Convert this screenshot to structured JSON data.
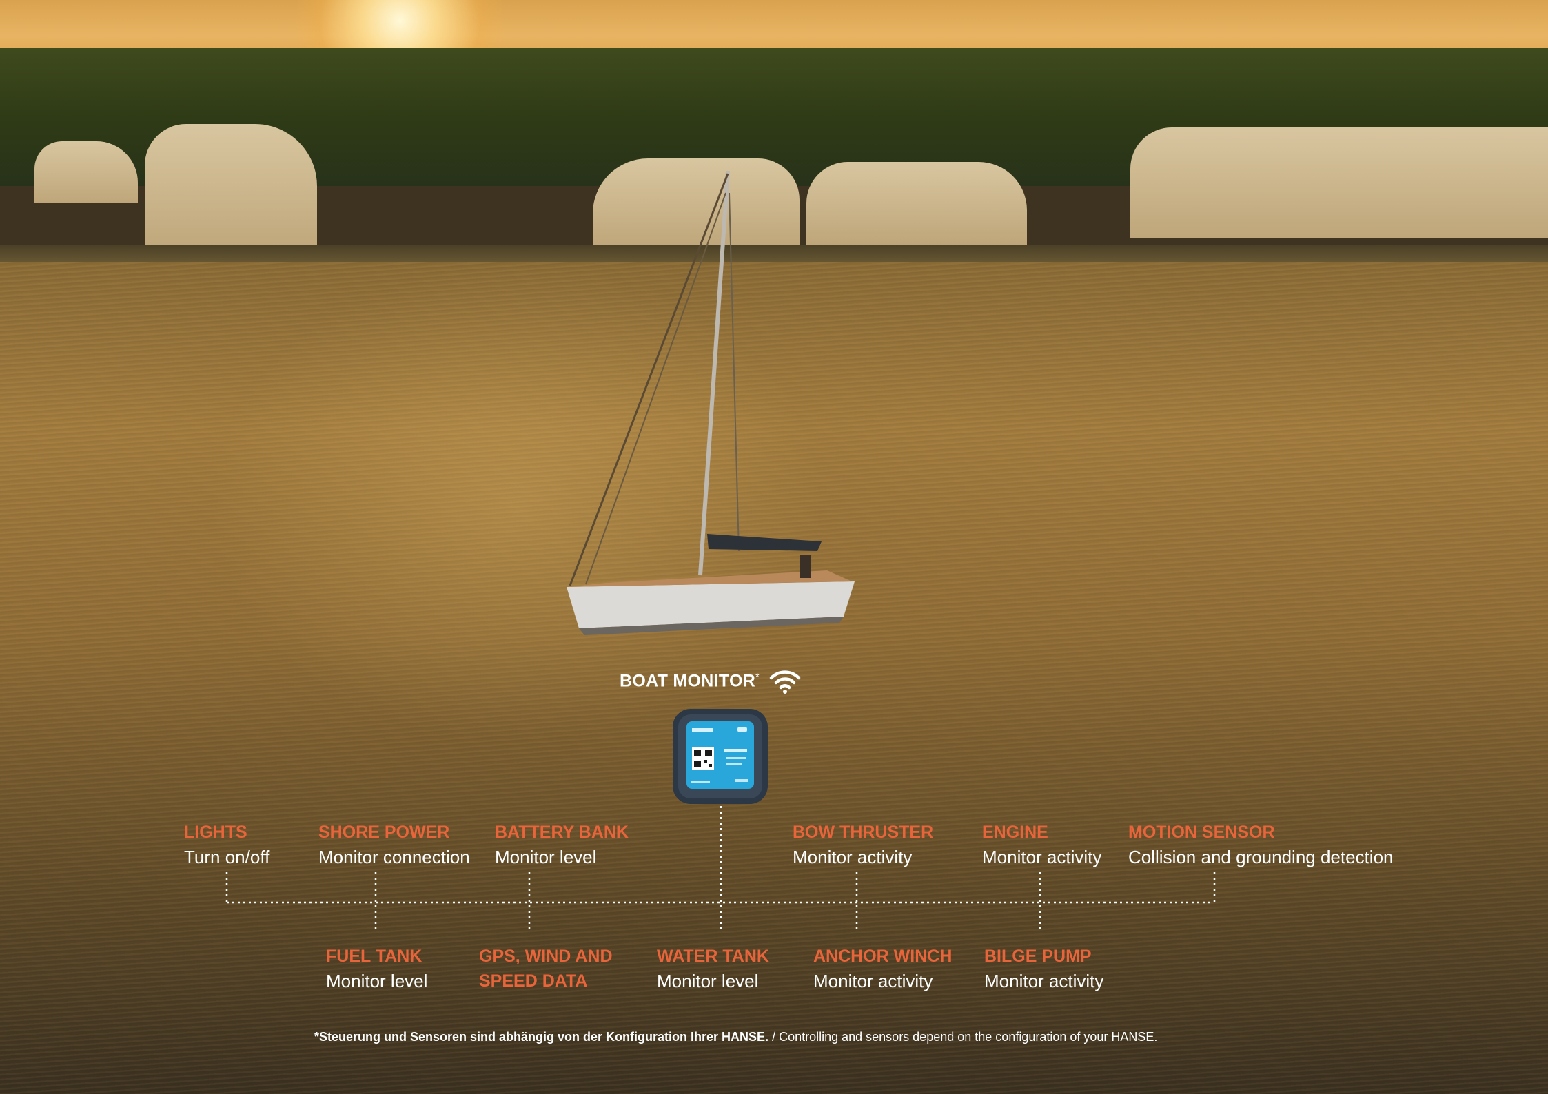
{
  "monitor": {
    "title": "BOAT MONITOR",
    "mark": "*",
    "icon": "wifi-icon"
  },
  "features_top": [
    {
      "name": "LIGHTS",
      "desc": "Turn on/off"
    },
    {
      "name": "SHORE POWER",
      "desc": "Monitor connection"
    },
    {
      "name": "BATTERY BANK",
      "desc": "Monitor level"
    },
    {
      "name": "BOW THRUSTER",
      "desc": "Monitor activity"
    },
    {
      "name": "ENGINE",
      "desc": "Monitor activity"
    },
    {
      "name": "MOTION SENSOR",
      "desc": "Collision and grounding detection"
    }
  ],
  "features_bottom": [
    {
      "name": "FUEL TANK",
      "desc": "Monitor level"
    },
    {
      "name": "GPS, WIND AND",
      "name2": "SPEED DATA",
      "desc": ""
    },
    {
      "name": "WATER TANK",
      "desc": "Monitor level"
    },
    {
      "name": "ANCHOR WINCH",
      "desc": "Monitor activity"
    },
    {
      "name": "BILGE PUMP",
      "desc": "Monitor activity"
    }
  ],
  "footnote": {
    "de": "*Steuerung und Sensoren sind abhängig von der Konfiguration Ihrer HANSE.",
    "sep": " / ",
    "en": "Controlling and sensors depend on the configuration of your HANSE."
  },
  "colors": {
    "accent": "#e8643a",
    "text": "#ffffff"
  }
}
